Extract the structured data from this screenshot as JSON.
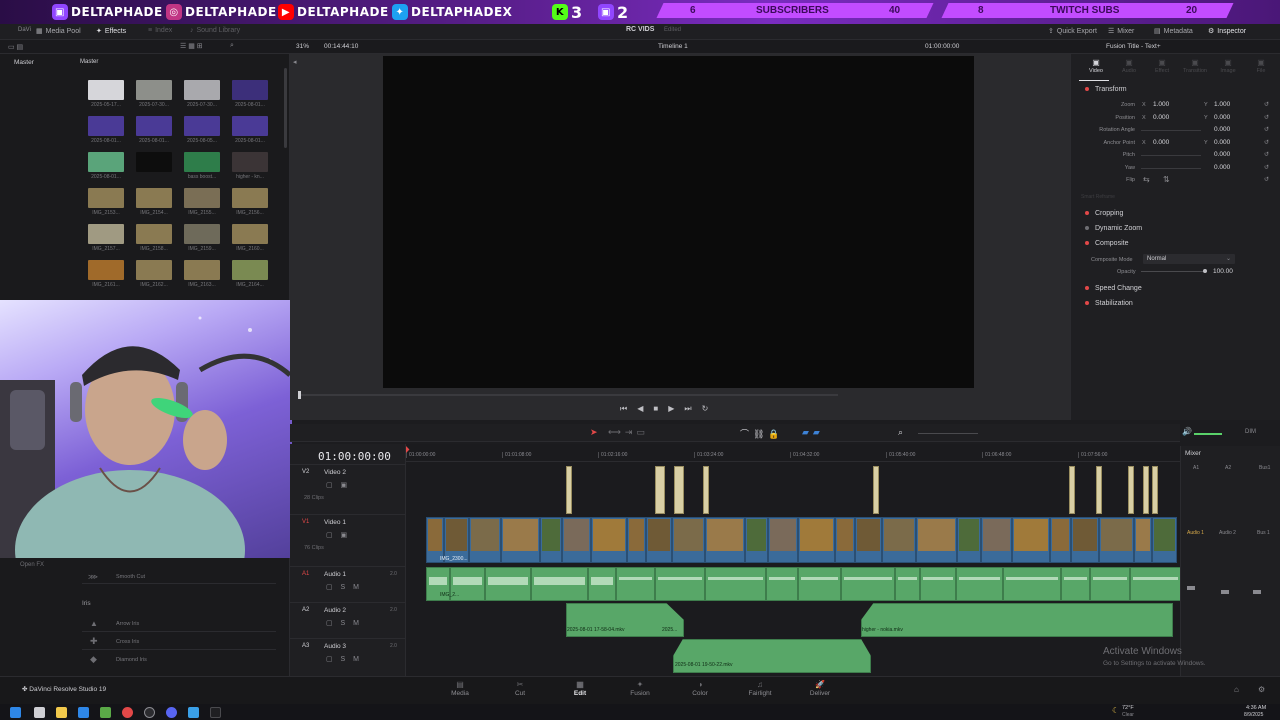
{
  "banner": {
    "socials": [
      "DELTAPHADE",
      "DELTAPHADE",
      "DELTAPHADE",
      "DELTAPHADEX"
    ],
    "kick_count": "3",
    "twitch_count": "2",
    "subscribers": {
      "current": "6",
      "label": "SUBSCRIBERS",
      "goal": "40"
    },
    "twitch_subs": {
      "current": "8",
      "label": "TWITCH SUBS",
      "goal": "20"
    }
  },
  "chrome": {
    "app_badge": "DaVi",
    "tabs": [
      "Media Pool",
      "Effects",
      "Index",
      "Sound Library"
    ],
    "project_title": "RC VIDS",
    "project_status": "Edited",
    "right_tabs": [
      "Quick Export",
      "Mixer",
      "Metadata",
      "Inspector"
    ]
  },
  "toolbar": {
    "zoom": "31%",
    "timecode_left": "00:14:44:10",
    "timeline_name": "Timeline 1",
    "timecode_right": "01:00:00:00",
    "inspector_title": "Fusion Title - Text+"
  },
  "pool": {
    "header_left": "Master",
    "header_right": "Master",
    "thumbs": [
      {
        "label": "2025-05-17...",
        "color": "#d6d6da"
      },
      {
        "label": "2025-07-30...",
        "color": "#8d8f8a"
      },
      {
        "label": "2025-07-30...",
        "color": "#a9a9ad"
      },
      {
        "label": "2025-08-01...",
        "color": "#3c2f7a"
      },
      {
        "label": "2025-08-01...",
        "color": "#4a3a96"
      },
      {
        "label": "2025-08-01...",
        "color": "#4a3a96"
      },
      {
        "label": "2025-08-05...",
        "color": "#4a3a96"
      },
      {
        "label": "2025-08-01...",
        "color": "#4a3a96"
      },
      {
        "label": "2025-08-01...",
        "color": "#5aa47a"
      },
      {
        "label": "",
        "color": "#0d0d0d"
      },
      {
        "label": "bass boost...",
        "color": "#2e7d4a"
      },
      {
        "label": "higher - kn...",
        "color": "#3b3436"
      },
      {
        "label": "IMG_2153...",
        "color": "#8a7a52"
      },
      {
        "label": "IMG_2154...",
        "color": "#8a7a52"
      },
      {
        "label": "IMG_2155...",
        "color": "#7a6e55"
      },
      {
        "label": "IMG_2156...",
        "color": "#8a7a52"
      },
      {
        "label": "IMG_2157...",
        "color": "#a09a82"
      },
      {
        "label": "IMG_2158...",
        "color": "#8a7a52"
      },
      {
        "label": "IMG_2159...",
        "color": "#6e6a5a"
      },
      {
        "label": "IMG_2160...",
        "color": "#8a7a52"
      },
      {
        "label": "IMG_2161...",
        "color": "#a06a2a"
      },
      {
        "label": "IMG_2162...",
        "color": "#8a7a52"
      },
      {
        "label": "IMG_2163...",
        "color": "#8a7a52"
      },
      {
        "label": "IMG_2164...",
        "color": "#7a8a52"
      }
    ]
  },
  "effects": {
    "items": [
      "Open FX",
      "Smooth Cut"
    ],
    "section": "Iris",
    "iris": [
      "Arrow Iris",
      "Cross Iris",
      "Diamond Iris"
    ]
  },
  "inspector": {
    "tabs": [
      "Video",
      "Audio",
      "Effect",
      "Transition",
      "Image",
      "File"
    ],
    "transform": "Transform",
    "rows": [
      {
        "label": "Zoom",
        "x": "1.000",
        "y": "1.000"
      },
      {
        "label": "Position",
        "x": "0.000",
        "y": "0.000"
      },
      {
        "label": "Rotation Angle",
        "x": "",
        "y": "0.000"
      },
      {
        "label": "Anchor Point",
        "x": "0.000",
        "y": "0.000"
      },
      {
        "label": "Pitch",
        "x": "",
        "y": "0.000"
      },
      {
        "label": "Yaw",
        "x": "",
        "y": "0.000"
      },
      {
        "label": "Flip",
        "x": "",
        "y": ""
      }
    ],
    "reset_label": "Smart Reframe",
    "sections": [
      "Cropping",
      "Dynamic Zoom",
      "Composite"
    ],
    "composite_mode_label": "Composite Mode",
    "composite_mode_value": "Normal",
    "opacity_label": "Opacity",
    "opacity_value": "100.00",
    "more_sections": [
      "Speed Change",
      "Stabilization"
    ]
  },
  "timeline": {
    "timecode": "01:00:00:00",
    "ruler": [
      "01:00:00:00",
      "01:01:08:00",
      "01:02:16:00",
      "01:03:24:00",
      "01:04:32:00",
      "01:05:40:00",
      "01:06:48:00",
      "01:07:56:00"
    ],
    "dim": "DIM",
    "tracks": [
      {
        "id": "V2",
        "name": "Video 2",
        "clips": "28 Clips"
      },
      {
        "id": "V1",
        "name": "Video 1",
        "clips": "76 Clips"
      },
      {
        "id": "A1",
        "name": "Audio 1",
        "level": "2.0"
      },
      {
        "id": "A2",
        "name": "Audio 2",
        "level": "2.0"
      },
      {
        "id": "A3",
        "name": "Audio 3",
        "level": "2.0"
      }
    ],
    "clip_labels": {
      "v1_first": "IMG_2300...",
      "a2_first": "2025-08-01 17-58-04.mkv",
      "a2_second": "2025...",
      "a2_third": "higher - nokia.mkv",
      "a3_first": "2025-08-01 19-50-22.mkv",
      "a1_first": "IMG_2..."
    }
  },
  "mixer": {
    "title": "Mixer",
    "cols": [
      "A1",
      "A2",
      "Bus1"
    ],
    "names": [
      "Audio 1",
      "Audio 2",
      "Bus 1"
    ]
  },
  "pages": [
    "Media",
    "Cut",
    "Edit",
    "Fusion",
    "Color",
    "Fairlight",
    "Deliver"
  ],
  "brand": "DaVinci Resolve Studio 19",
  "watermark": {
    "title": "Activate Windows",
    "sub": "Go to Settings to activate Windows."
  },
  "taskbar": {
    "weather": "72°F",
    "weather_sub": "Clear",
    "time": "4:36 AM",
    "date": "8/9/2025"
  }
}
